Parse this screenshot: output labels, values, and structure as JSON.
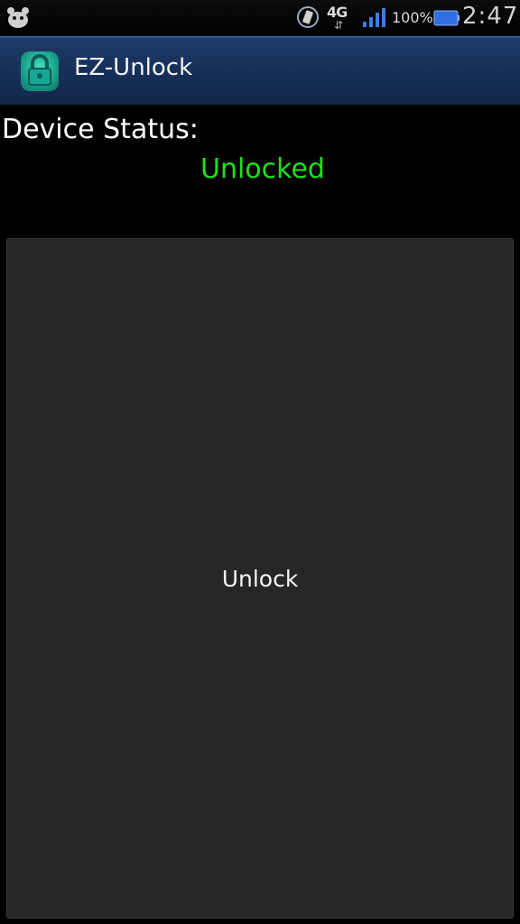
{
  "status_bar": {
    "notification_icon": "android-notification-icon",
    "sync_icon": "sync-icon",
    "network": "4G",
    "network_arrows": "⇵",
    "signal_icon": "signal-bars-icon",
    "battery_percent": "100%",
    "battery_icon": "battery-icon",
    "time": "2:47"
  },
  "title_bar": {
    "app_icon": "lock-icon",
    "title": "EZ-Unlock",
    "background_color": "#17305a"
  },
  "content": {
    "device_status_label": "Device Status:",
    "device_status_value": "Unlocked",
    "status_color": "#1fe01f",
    "unlock_button_label": "Unlock"
  }
}
